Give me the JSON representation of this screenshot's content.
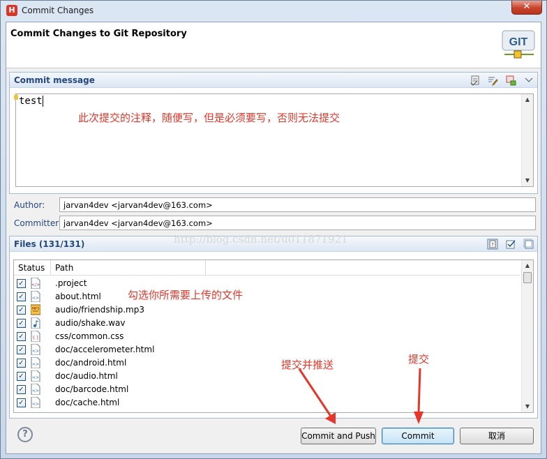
{
  "window": {
    "title": "Commit Changes",
    "app_icon_letter": "H",
    "close_glyph": "✕"
  },
  "header": {
    "title": "Commit Changes to Git Repository",
    "logo_text": "GIT"
  },
  "commit_message": {
    "section_title": "Commit message",
    "text": "test",
    "annotation": "此次提交的注释，随便写，但是必须要写，否则无法提交",
    "icons": [
      "spell-check-icon",
      "edit-icon",
      "add-signed-off-icon",
      "view-menu-icon"
    ]
  },
  "author": {
    "label": "Author:",
    "value": "jarvan4dev <jarvan4dev@163.com>"
  },
  "committer": {
    "label": "Committer:",
    "value": "jarvan4dev <jarvan4dev@163.com>"
  },
  "watermark": "http://blog.csdn.net/u011871921",
  "files": {
    "section_title": "Files (131/131)",
    "annotation": "勾选你所需要上传的文件",
    "columns": [
      "Status",
      "Path"
    ],
    "rows": [
      {
        "path": ".project",
        "checked": true,
        "icon": "xml-file-icon"
      },
      {
        "path": "about.html",
        "checked": true,
        "icon": "html-file-icon"
      },
      {
        "path": "audio/friendship.mp3",
        "checked": true,
        "icon": "mp3-file-icon"
      },
      {
        "path": "audio/shake.wav",
        "checked": true,
        "icon": "audio-file-icon"
      },
      {
        "path": "css/common.css",
        "checked": true,
        "icon": "css-file-icon"
      },
      {
        "path": "doc/accelerometer.html",
        "checked": true,
        "icon": "html-file-icon"
      },
      {
        "path": "doc/android.html",
        "checked": true,
        "icon": "html-file-icon"
      },
      {
        "path": "doc/audio.html",
        "checked": true,
        "icon": "html-file-icon"
      },
      {
        "path": "doc/barcode.html",
        "checked": true,
        "icon": "html-file-icon"
      },
      {
        "path": "doc/cache.html",
        "checked": true,
        "icon": "html-file-icon"
      }
    ]
  },
  "arrows": {
    "commit_push_label": "提交并推送",
    "commit_label": "提交"
  },
  "buttons": {
    "help_glyph": "?",
    "commit_and_push": "Commit and Push",
    "commit": "Commit",
    "cancel": "取消"
  },
  "colors": {
    "annotation": "#e4362a",
    "section_title": "#25467e"
  }
}
